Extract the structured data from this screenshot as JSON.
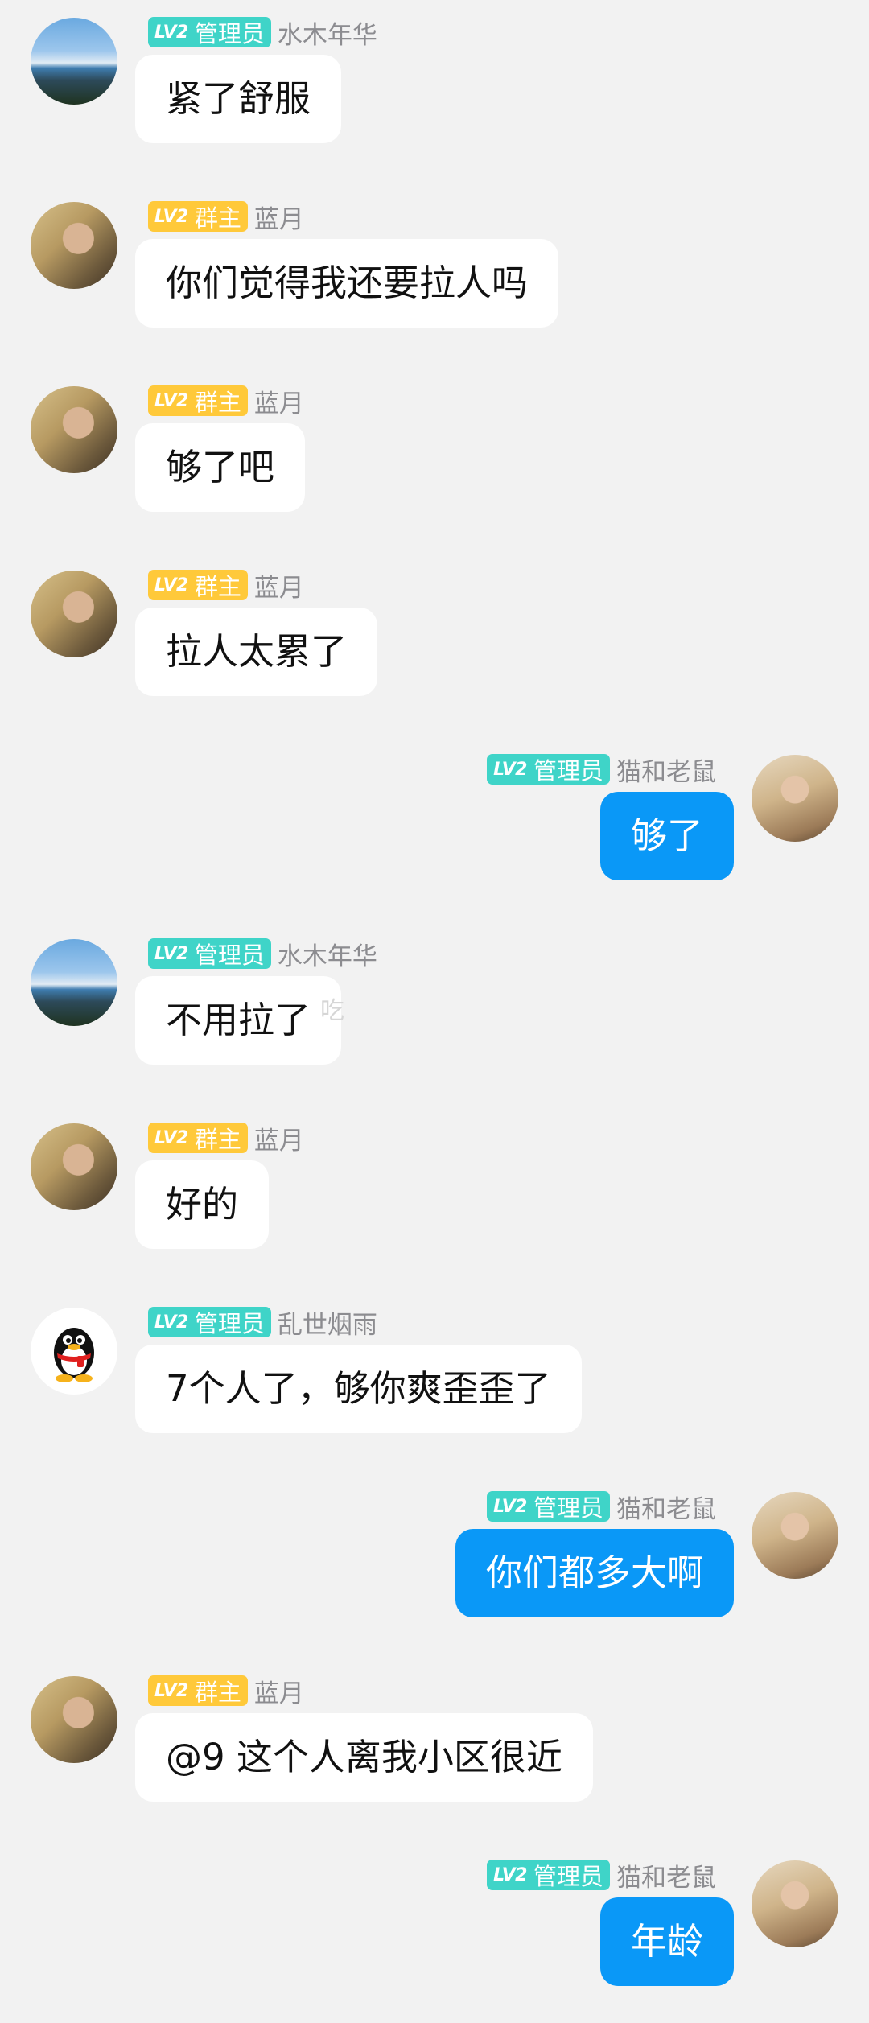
{
  "badges": {
    "level": "LV2",
    "admin_label": "管理员",
    "owner_label": "群主",
    "admin_color": "#3fd4c8",
    "owner_color": "#ffc93a"
  },
  "colors": {
    "background": "#f2f2f2",
    "incoming_bubble": "#ffffff",
    "outgoing_bubble": "#0a98f7",
    "nickname": "#8c8c90"
  },
  "messages": [
    {
      "side": "left",
      "role": "admin",
      "nick": "水木年华",
      "text": "紧了舒服",
      "avatar": "sky-avatar"
    },
    {
      "side": "left",
      "role": "owner",
      "nick": "蓝月",
      "text": "你们觉得我还要拉人吗",
      "avatar": "girl-avatar"
    },
    {
      "side": "left",
      "role": "owner",
      "nick": "蓝月",
      "text": "够了吧",
      "avatar": "girl-avatar"
    },
    {
      "side": "left",
      "role": "owner",
      "nick": "蓝月",
      "text": "拉人太累了",
      "avatar": "girl-avatar"
    },
    {
      "side": "right",
      "role": "admin",
      "nick": "猫和老鼠",
      "text": "够了",
      "avatar": "self-avatar"
    },
    {
      "side": "left",
      "role": "admin",
      "nick": "水木年华",
      "text": "不用拉了",
      "avatar": "sky-avatar"
    },
    {
      "side": "left",
      "role": "owner",
      "nick": "蓝月",
      "text": "好的",
      "avatar": "girl-avatar"
    },
    {
      "side": "left",
      "role": "admin",
      "nick": "乱世烟雨",
      "text": "7个人了，够你爽歪歪了",
      "avatar": "qq-penguin-avatar"
    },
    {
      "side": "right",
      "role": "admin",
      "nick": "猫和老鼠",
      "text": "你们都多大啊",
      "avatar": "self-avatar"
    },
    {
      "side": "left",
      "role": "owner",
      "nick": "蓝月",
      "text": "@9 这个人离我小区很近",
      "avatar": "girl-avatar"
    },
    {
      "side": "right",
      "role": "admin",
      "nick": "猫和老鼠",
      "text": "年龄",
      "avatar": "self-avatar"
    }
  ],
  "stray_glyph": "吃"
}
